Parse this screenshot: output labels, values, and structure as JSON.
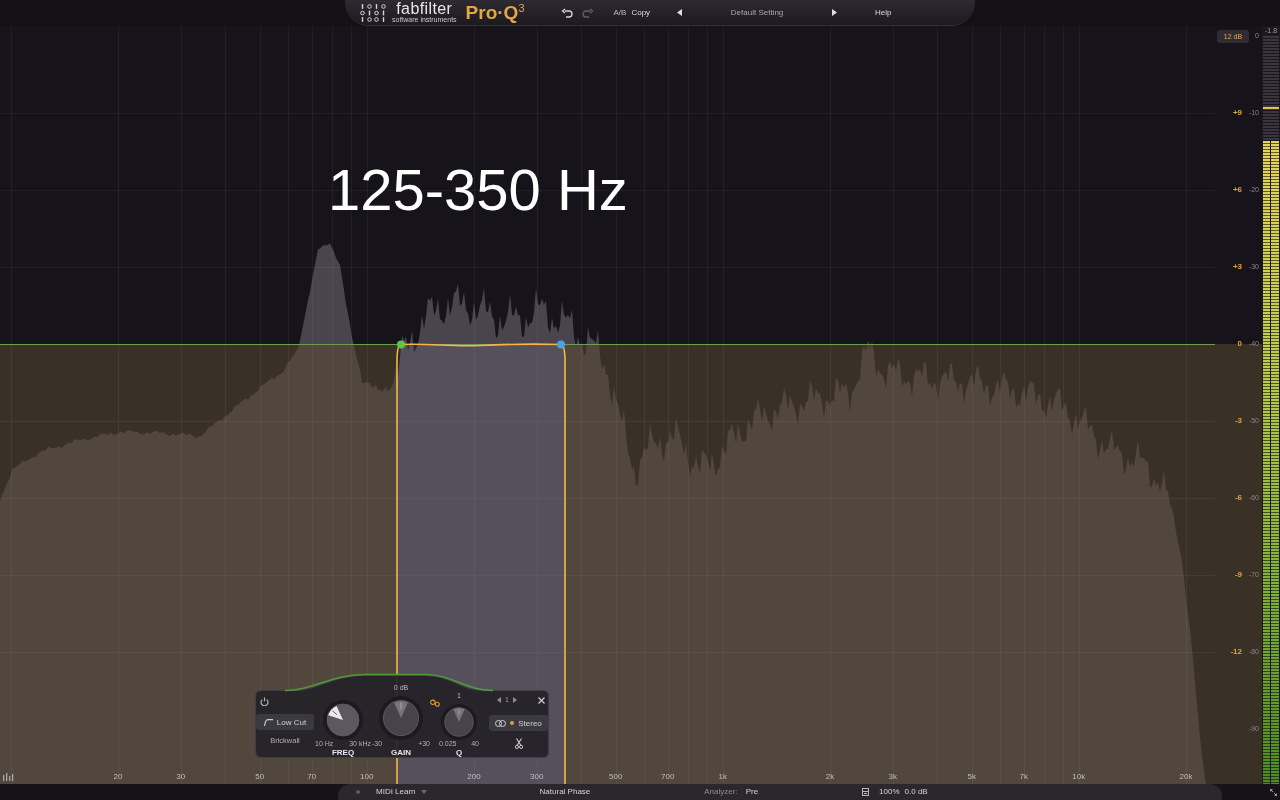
{
  "header": {
    "brand": "fabfilter",
    "tagline": "software instruments",
    "product": "Pro·Q$^{3}$",
    "undo": {
      "disabled": false
    },
    "redo": {
      "disabled": true
    },
    "ab": "A/B",
    "copy": "Copy",
    "preset": "Default Setting",
    "help": "Help"
  },
  "graph": {
    "caption": "125-350 Hz",
    "range_button": "12 dB",
    "spectrum_top_label": "0",
    "gain_scale": [
      "+9",
      "+6",
      "+3",
      "0",
      "-3",
      "-6",
      "-9",
      "-12"
    ],
    "spectrum_scale": [
      "-10",
      "-20",
      "-30",
      "-40",
      "-50",
      "-60",
      "-70",
      "-80",
      "-90"
    ],
    "freq_labels": [
      "20",
      "30",
      "50",
      "70",
      "100",
      "200",
      "300",
      "500",
      "700",
      "1k",
      "2k",
      "3k",
      "5k",
      "7k",
      "10k",
      "20k"
    ],
    "bands": [
      {
        "color": "#5fc24a"
      },
      {
        "color": "#4aa3e0"
      }
    ]
  },
  "band_panel": {
    "filter_type": "Low Cut",
    "slope": "Brickwall",
    "knobs": [
      {
        "label": "FREQ",
        "min": "10 Hz",
        "max": "30 kHz",
        "level": 0.32,
        "active": true
      },
      {
        "label": "GAIN",
        "value": "0 dB",
        "min": "-30",
        "max": "+30",
        "level": 0.5,
        "active": false
      },
      {
        "label": "Q",
        "value": "1",
        "min": "0.025",
        "max": "40",
        "level": 0.5,
        "active": false
      }
    ],
    "band_number": "1",
    "stereo": "Stereo"
  },
  "meter": {
    "reading": "-1.8",
    "level": 0.86
  },
  "status_bar": {
    "midi_learn": {
      "label": "MIDI Learn",
      "on": false
    },
    "phase_mode": "Natural Phase",
    "analyzer_label": "Analyzer:",
    "analyzer_value": "Pre",
    "zoom": "100%",
    "output_gain": "0.0 dB"
  }
}
